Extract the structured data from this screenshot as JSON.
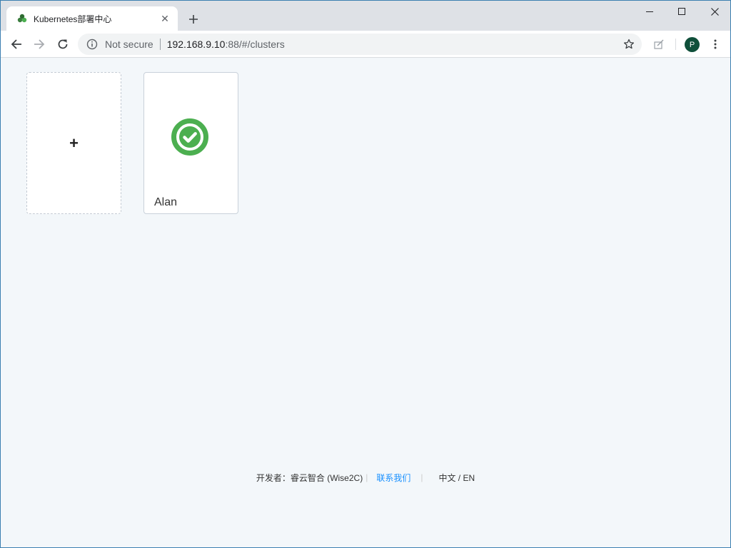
{
  "browser": {
    "tab": {
      "title": "Kubernetes部署中心",
      "close_glyph": "✕",
      "favicon": "kubernetes-cluster-icon"
    },
    "new_tab_icon": "plus-icon",
    "window_controls": [
      "minimize-icon",
      "maximize-icon",
      "close-icon"
    ],
    "address": {
      "security_label": "Not secure",
      "url_host": "192.168.9.10",
      "url_rest": ":88/#/clusters"
    },
    "avatar_letter": "P"
  },
  "page": {
    "add_card": {
      "plus": "+"
    },
    "clusters": [
      {
        "name": "Alan",
        "status": "healthy",
        "status_color": "#4caf50"
      }
    ]
  },
  "footer": {
    "developer_label": "开发者：",
    "developer_name": "睿云智合 (Wise2C)",
    "contact_link": "联系我们",
    "language_switch": "中文 / EN"
  },
  "colors": {
    "accent_link": "#1890ff",
    "success": "#4caf50",
    "background": "#f3f7fa"
  }
}
